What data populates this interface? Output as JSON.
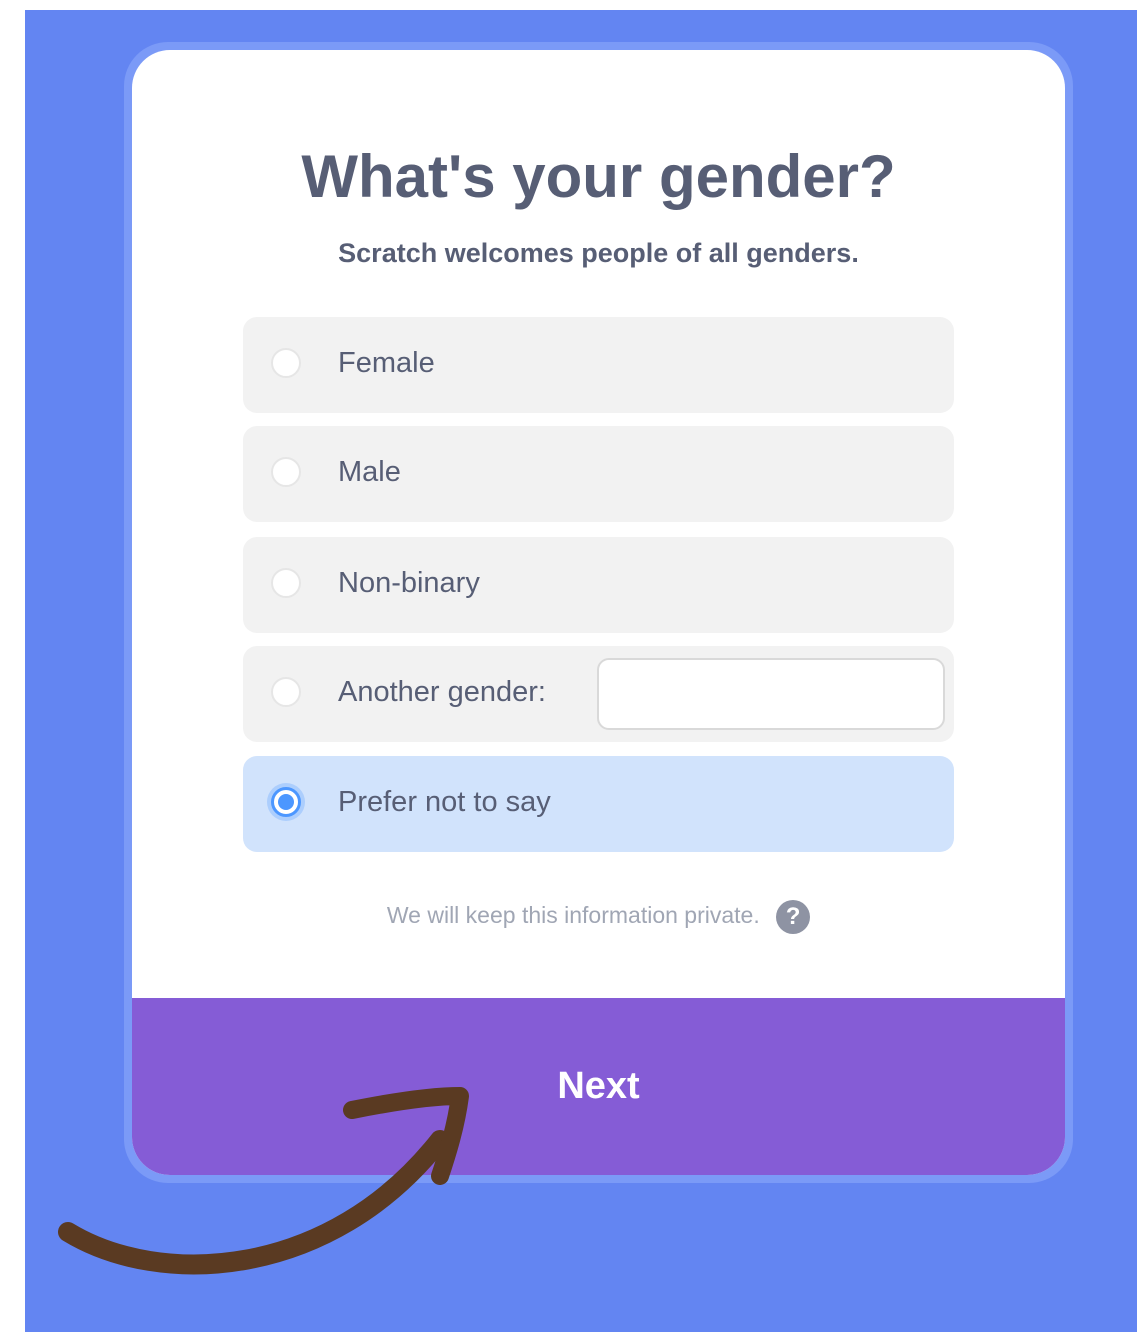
{
  "dialog": {
    "title": "What's your gender?",
    "subtitle": "Scratch welcomes people of all genders."
  },
  "options": [
    {
      "label": "Female",
      "selected": false
    },
    {
      "label": "Male",
      "selected": false
    },
    {
      "label": "Non-binary",
      "selected": false
    },
    {
      "label": "Another gender:",
      "selected": false,
      "input_value": ""
    },
    {
      "label": "Prefer not to say",
      "selected": true
    }
  ],
  "privacy_note": "We will keep this information private.",
  "help_icon": {
    "name": "question-mark-icon",
    "glyph": "?"
  },
  "next_button": {
    "label": "Next"
  },
  "annotation": {
    "icon": "hand-drawn-arrow-icon",
    "color": "#5a3a22"
  },
  "colors": {
    "background": "#6385f2",
    "next_bar": "#855cd6",
    "selected_option": "#d1e3fc",
    "radio_accent": "#4c97ff",
    "text": "#575e75"
  }
}
